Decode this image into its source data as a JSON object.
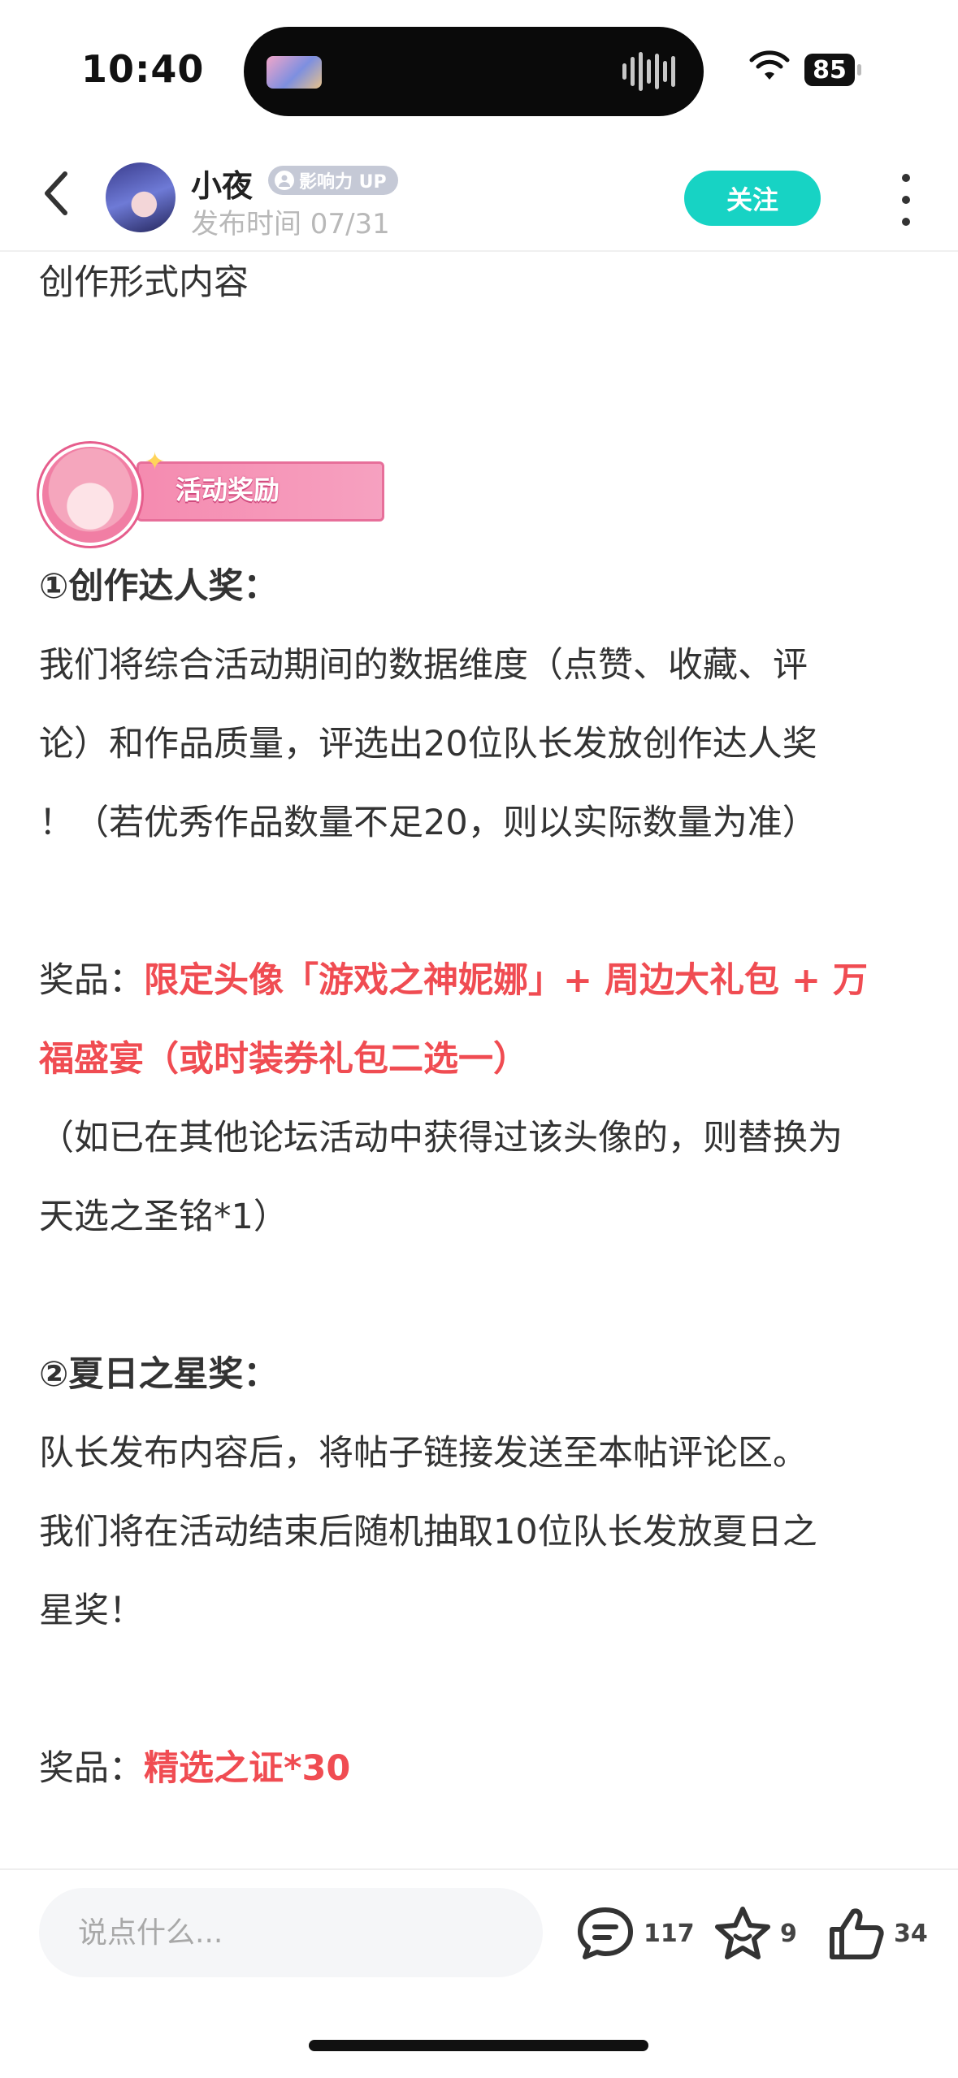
{
  "status_bar": {
    "time": "10:40",
    "battery": "85"
  },
  "header": {
    "username": "小夜",
    "badge": "影响力 UP",
    "publish_time": "发布时间 07/31",
    "follow_label": "关注"
  },
  "post": {
    "intro": "创作形式内容",
    "banner_label": "活动奖励",
    "section1": {
      "heading": "①创作达人奖：",
      "lines": [
        "我们将综合活动期间的数据维度（点赞、收藏、评",
        "论）和作品质量，评选出20位队长发放创作达人奖",
        "！（若优秀作品数量不足20，则以实际数量为准）"
      ],
      "prize_label": "奖品：",
      "prize_line1": "限定头像「游戏之神妮娜」+ 周边大礼包 + 万",
      "prize_line2": "福盛宴（或时装券礼包二选一）",
      "note_lines": [
        "（如已在其他论坛活动中获得过该头像的，则替换为",
        "天选之圣铭*1）"
      ]
    },
    "section2": {
      "heading": "②夏日之星奖：",
      "lines": [
        "队长发布内容后，将帖子链接发送至本帖评论区。",
        "我们将在活动结束后随机抽取10位队长发放夏日之",
        "星奖！"
      ],
      "prize_label": "奖品：",
      "prize": "精选之证*30"
    }
  },
  "bottom_bar": {
    "comment_placeholder": "说点什么...",
    "comments_count": "117",
    "favorites_count": "9",
    "likes_count": "34"
  },
  "colors": {
    "accent": "#17d3c4",
    "prize_red": "#f04c52"
  }
}
